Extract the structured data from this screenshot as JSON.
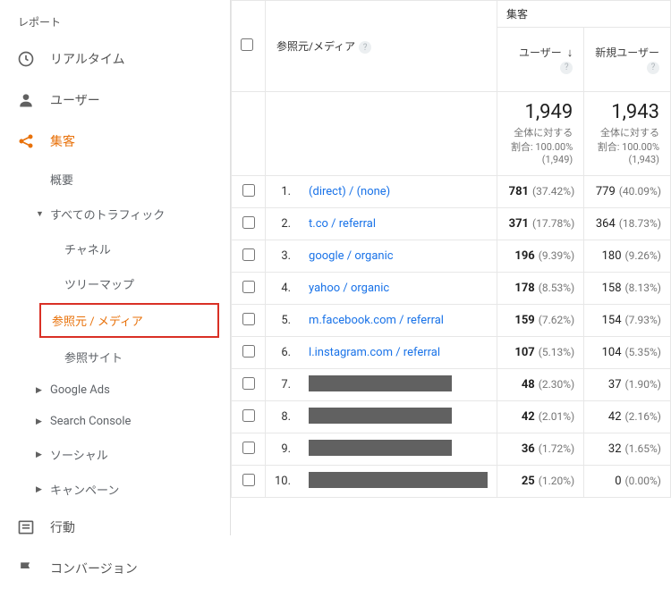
{
  "sidebar": {
    "title": "レポート",
    "items": [
      {
        "label": "リアルタイム",
        "icon": "clock"
      },
      {
        "label": "ユーザー",
        "icon": "user"
      },
      {
        "label": "集客",
        "icon": "share",
        "active": true
      },
      {
        "label": "行動",
        "icon": "list"
      },
      {
        "label": "コンバージョン",
        "icon": "flag"
      }
    ],
    "acq": {
      "overview": "概要",
      "all_traffic": "すべてのトラフィック",
      "sub": [
        "チャネル",
        "ツリーマップ",
        "参照元 / メディア",
        "参照サイト"
      ],
      "rest": [
        "Google Ads",
        "Search Console",
        "ソーシャル",
        "キャンペーン"
      ]
    }
  },
  "table": {
    "group_header": "集客",
    "dim_header": "参照元/メディア",
    "col_user": "ユーザー",
    "col_new": "新規ユーザー",
    "summary": {
      "user_total": "1,949",
      "user_sub": "全体に対する割合: 100.00% (1,949)",
      "new_total": "1,943",
      "new_sub": "全体に対する割合: 100.00% (1,943)"
    },
    "rows": [
      {
        "i": "1.",
        "src": "(direct) / (none)",
        "u": "781",
        "up": "(37.42%)",
        "n": "779",
        "np": "(40.09%)"
      },
      {
        "i": "2.",
        "src": "t.co / referral",
        "u": "371",
        "up": "(17.78%)",
        "n": "364",
        "np": "(18.73%)"
      },
      {
        "i": "3.",
        "src": "google / organic",
        "u": "196",
        "up": "(9.39%)",
        "n": "180",
        "np": "(9.26%)"
      },
      {
        "i": "4.",
        "src": "yahoo / organic",
        "u": "178",
        "up": "(8.53%)",
        "n": "158",
        "np": "(8.13%)"
      },
      {
        "i": "5.",
        "src": "m.facebook.com / referral",
        "u": "159",
        "up": "(7.62%)",
        "n": "154",
        "np": "(7.93%)"
      },
      {
        "i": "6.",
        "src": "l.instagram.com / referral",
        "u": "107",
        "up": "(5.13%)",
        "n": "104",
        "np": "(5.35%)"
      },
      {
        "i": "7.",
        "mask": 160,
        "u": "48",
        "up": "(2.30%)",
        "n": "37",
        "np": "(1.90%)"
      },
      {
        "i": "8.",
        "mask": 160,
        "u": "42",
        "up": "(2.01%)",
        "n": "42",
        "np": "(2.16%)"
      },
      {
        "i": "9.",
        "mask": 160,
        "u": "36",
        "up": "(1.72%)",
        "n": "32",
        "np": "(1.65%)"
      },
      {
        "i": "10.",
        "mask": 200,
        "u": "25",
        "up": "(1.20%)",
        "n": "0",
        "np": "(0.00%)"
      }
    ]
  }
}
